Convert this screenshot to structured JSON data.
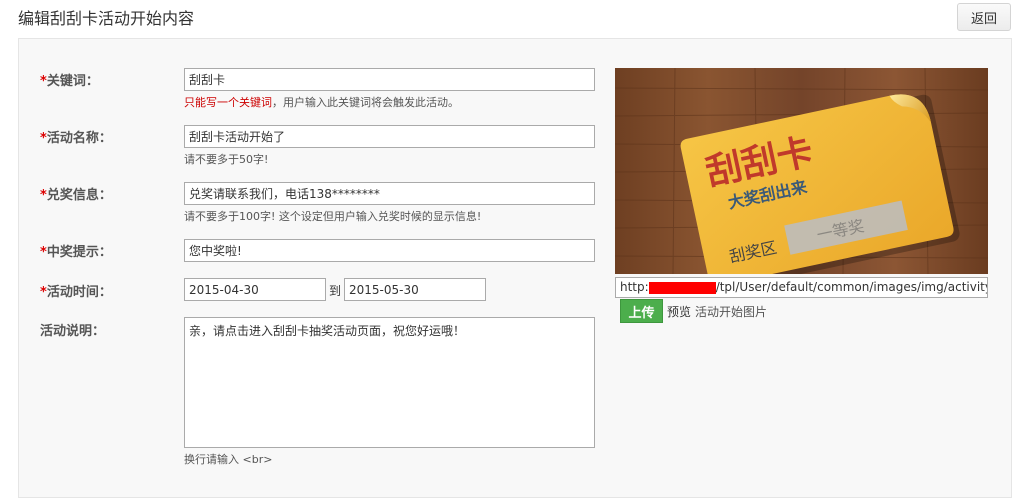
{
  "header": {
    "title": "编辑刮刮卡活动开始内容",
    "back_label": "返回"
  },
  "form": {
    "keyword": {
      "star": "*",
      "label": "关键词：",
      "value": "刮刮卡",
      "hint_red": "只能写一个关键词",
      "hint_rest": "，用户输入此关键词将会触发此活动。"
    },
    "name": {
      "star": "*",
      "label": "活动名称：",
      "value": "刮刮卡活动开始了",
      "hint": "请不要多于50字!"
    },
    "prize_info": {
      "star": "*",
      "label": "兑奖信息：",
      "value": "兑奖请联系我们，电话138********",
      "hint": "请不要多于100字! 这个设定但用户输入兑奖时候的显示信息!"
    },
    "win_tip": {
      "star": "*",
      "label": "中奖提示：",
      "value": "您中奖啦!"
    },
    "time": {
      "star": "*",
      "label": "活动时间：",
      "start": "2015-04-30",
      "to": "到",
      "end": "2015-05-30"
    },
    "desc": {
      "label": "活动说明：",
      "value": "亲，请点击进入刮刮卡抽奖活动页面，祝您好运哦！",
      "hint": "换行请输入 <br>"
    }
  },
  "image_panel": {
    "card_title": "刮刮卡",
    "card_subtitle": "大奖刮出来",
    "card_area": "刮奖区",
    "card_prize": "一等奖",
    "url_prefix": "http:",
    "url_suffix": "/tpl/User/default/common/images/img/activity-scratch-card-start.jpg",
    "upload_label": "上传",
    "preview_label": "预览",
    "caption": "活动开始图片"
  },
  "colors": {
    "accent_green": "#4cae4c",
    "required_red": "#cc0000",
    "card_yellow": "#f2b632",
    "wood_brown": "#7a4a2a"
  }
}
